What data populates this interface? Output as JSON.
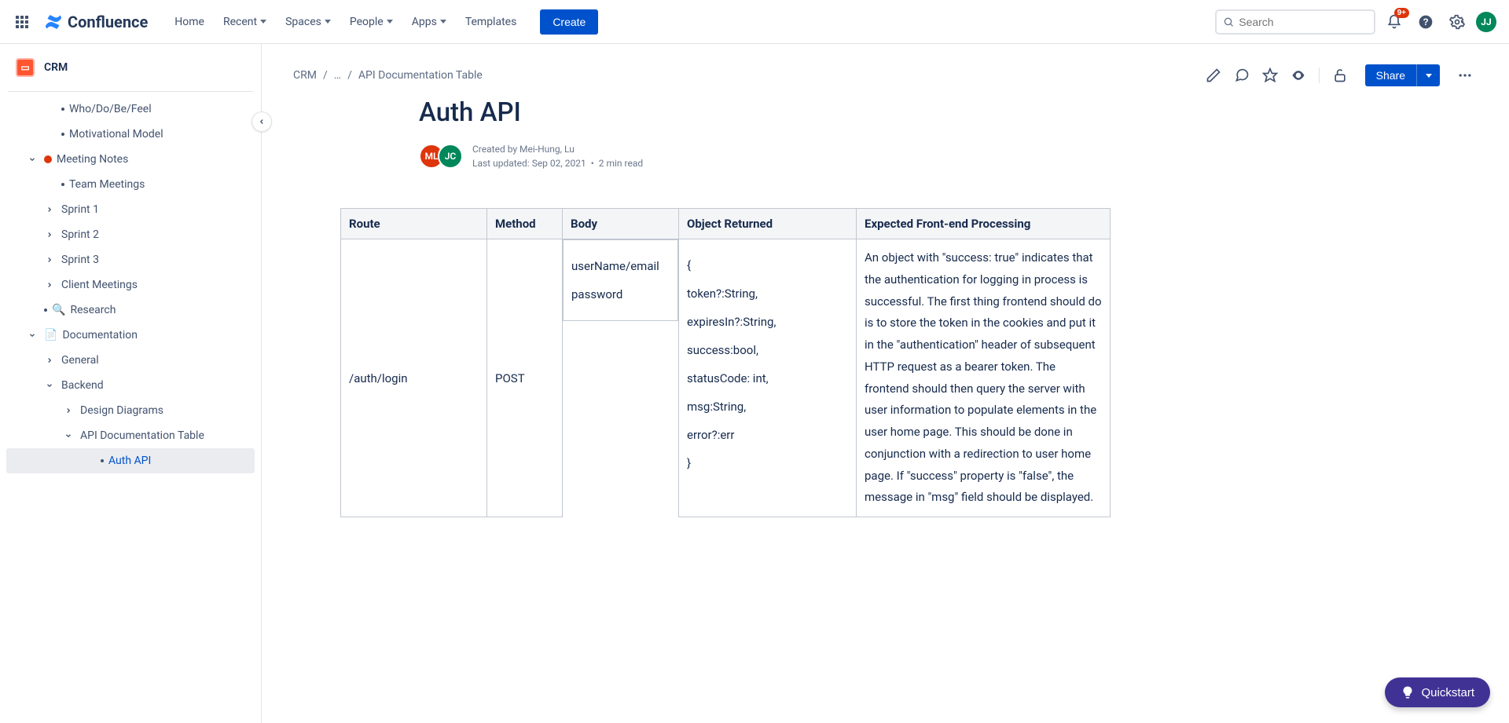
{
  "nav": {
    "brand": "Confluence",
    "items": [
      "Home",
      "Recent",
      "Spaces",
      "People",
      "Apps",
      "Templates"
    ],
    "create": "Create",
    "search_placeholder": "Search",
    "notif_badge": "9+",
    "avatar_initials": "JJ"
  },
  "space": {
    "name": "CRM"
  },
  "sidebar": {
    "items": [
      {
        "label": "Who/Do/Be/Feel",
        "level": 2,
        "bullet": true
      },
      {
        "label": "Motivational Model",
        "level": 2,
        "bullet": true
      },
      {
        "label": "Meeting Notes",
        "level": 1,
        "expander": "down",
        "icon": "red-dot"
      },
      {
        "label": "Team Meetings",
        "level": 2,
        "bullet": true
      },
      {
        "label": "Sprint 1",
        "level": 2,
        "expander": "right"
      },
      {
        "label": "Sprint 2",
        "level": 2,
        "expander": "right"
      },
      {
        "label": "Sprint 3",
        "level": 2,
        "expander": "right"
      },
      {
        "label": "Client Meetings",
        "level": 2,
        "expander": "right"
      },
      {
        "label": "Research",
        "level": 1,
        "bullet": true,
        "icon": "🔍"
      },
      {
        "label": "Documentation",
        "level": 1,
        "expander": "down",
        "icon": "📄"
      },
      {
        "label": "General",
        "level": 2,
        "expander": "right"
      },
      {
        "label": "Backend",
        "level": 2,
        "expander": "down"
      },
      {
        "label": "Design Diagrams",
        "level": 3,
        "expander": "right"
      },
      {
        "label": "API Documentation Table",
        "level": 3,
        "expander": "down"
      },
      {
        "label": "Auth API",
        "level": 4,
        "bullet": true,
        "active": true
      }
    ]
  },
  "breadcrumb": {
    "root": "CRM",
    "mid": "…",
    "leaf": "API Documentation Table"
  },
  "actions": {
    "share": "Share"
  },
  "page": {
    "title": "Auth API",
    "avatars": [
      "ML",
      "JC"
    ],
    "created_by_label": "Created by",
    "created_by": "Mei-Hung, Lu",
    "updated_label": "Last updated:",
    "updated": "Sep 02, 2021",
    "read_time": "2 min read"
  },
  "table": {
    "headers": [
      "Route",
      "Method",
      "Body",
      "Object Returned",
      "Expected Front-end Processing"
    ],
    "row": {
      "route": "/auth/login",
      "method": "POST",
      "body": "userName/email\n\npassword",
      "object": "{\n\ntoken?:String,\n\nexpiresIn?:String,\n\nsuccess:bool,\n\nstatusCode: int,\n\nmsg:String,\n\nerror?:err\n\n}",
      "processing": "An object with \"success: true\" indicates that the authentication for logging in process is successful. The first thing frontend should do is to store the token in the cookies and put it in the \"authentication\" header of subsequent HTTP request as a bearer token. The frontend should then query the server with user information to populate elements in the user home page. This should be done in conjunction with a redirection to user home page. If \"success\" property is \"false\", the message in \"msg\" field should be displayed."
    }
  },
  "quickstart": "Quickstart"
}
